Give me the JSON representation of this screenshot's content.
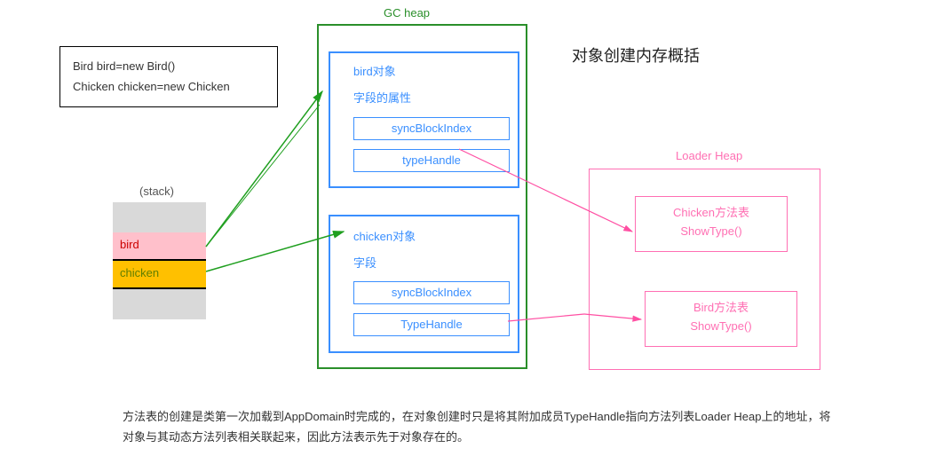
{
  "code_box": {
    "line1": "Bird bird=new Bird()",
    "line2": "Chicken chicken=new Chicken"
  },
  "stack": {
    "label": "(stack)",
    "bird": "bird",
    "chicken": "chicken"
  },
  "gc": {
    "title": "GC heap",
    "bird_obj": "bird对象",
    "bird_fields": "字段的属性",
    "bird_sbi": "syncBlockIndex",
    "bird_th": "typeHandle",
    "chicken_obj": "chicken对象",
    "chicken_fields": "字段",
    "chicken_sbi": "syncBlockIndex",
    "chicken_th": "TypeHandle"
  },
  "title": "对象创建内存概括",
  "loader": {
    "title": "Loader Heap",
    "chicken_mt_l1": "Chicken方法表",
    "chicken_mt_l2": "ShowType()",
    "bird_mt_l1": "Bird方法表",
    "bird_mt_l2": "ShowType()"
  },
  "footer": "方法表的创建是类第一次加载到AppDomain时完成的，在对象创建时只是将其附加成员TypeHandle指向方法列表Loader Heap上的地址，将对象与其动态方法列表相关联起来，因此方法表示先于对象存在的。"
}
